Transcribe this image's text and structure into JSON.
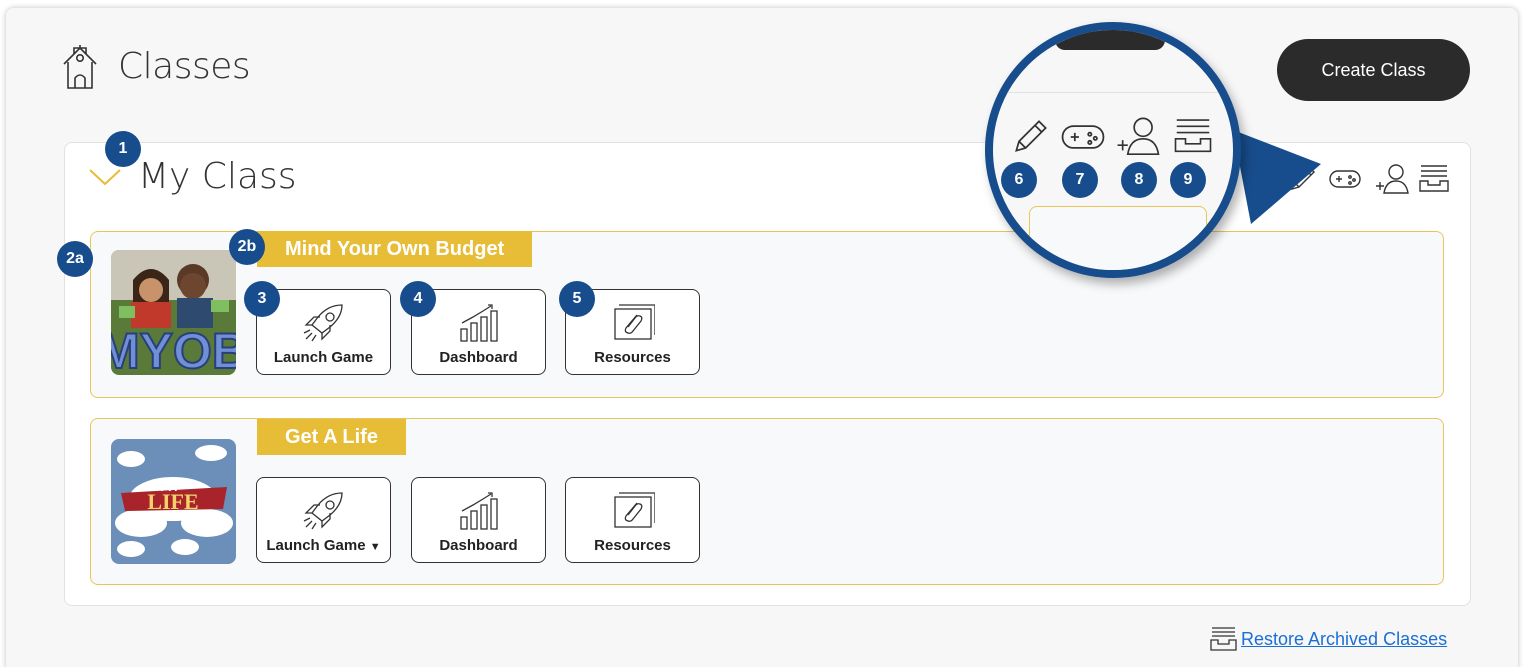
{
  "header": {
    "title": "Classes",
    "create_label": "Create Class",
    "icon": "schoolhouse-icon"
  },
  "class_panel": {
    "title": "My Class",
    "tool_icons": [
      "pencil-icon",
      "gamepad-icon",
      "add-user-icon",
      "archive-icon"
    ]
  },
  "games": [
    {
      "name": "Mind Your Own Budget",
      "thumbnail_text": "MYOB",
      "actions": [
        {
          "label": "Launch Game",
          "icon": "rocket-icon"
        },
        {
          "label": "Dashboard",
          "icon": "bar-chart-icon"
        },
        {
          "label": "Resources",
          "icon": "paperclip-folder-icon"
        }
      ]
    },
    {
      "name": "Get A Life",
      "thumbnail_text": "LIFE",
      "banner_text": "GET A",
      "actions": [
        {
          "label": "Launch Game",
          "icon": "rocket-icon",
          "has_dropdown": true
        },
        {
          "label": "Dashboard",
          "icon": "bar-chart-icon"
        },
        {
          "label": "Resources",
          "icon": "paperclip-folder-icon"
        }
      ]
    }
  ],
  "callouts": {
    "c1": "1",
    "c2a": "2a",
    "c2b": "2b",
    "c3": "3",
    "c4": "4",
    "c5": "5",
    "c6": "6",
    "c7": "7",
    "c8": "8",
    "c9": "9"
  },
  "footer": {
    "restore_label": "Restore Archived Classes"
  },
  "colors": {
    "accent_gold": "#e7bd38",
    "callout_blue": "#174d8c",
    "link_blue": "#1a6fd6",
    "button_dark": "#2b2b2b"
  }
}
